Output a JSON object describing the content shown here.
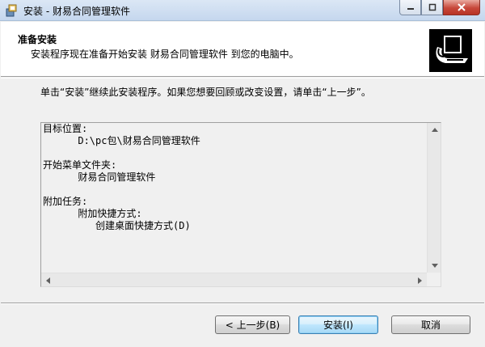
{
  "window": {
    "title": "安装 - 财易合同管理软件",
    "icon": "installer-icon",
    "controls": [
      "minimize-icon",
      "maximize-icon",
      "close-icon"
    ]
  },
  "header": {
    "title": "准备安装",
    "subtitle": "安装程序现在准备开始安装 财易合同管理软件 到您的电脑中。",
    "image": "computer-install-icon"
  },
  "intro": "单击“安装”继续此安装程序。如果您想要回顾或改变设置，请单击“上一步”。",
  "memo": {
    "lines": [
      "目标位置:",
      "      D:\\pc包\\财易合同管理软件",
      "",
      "开始菜单文件夹:",
      "      财易合同管理软件",
      "",
      "附加任务:",
      "      附加快捷方式:",
      "         创建桌面快捷方式(D)"
    ]
  },
  "buttons": {
    "back": "< 上一步(B)",
    "install": "安装(I)",
    "cancel": "取消"
  },
  "colors": {
    "title_bar": "#c5d7ee",
    "close_button": "#c7473a",
    "default_button_border": "#3c7fb1"
  }
}
